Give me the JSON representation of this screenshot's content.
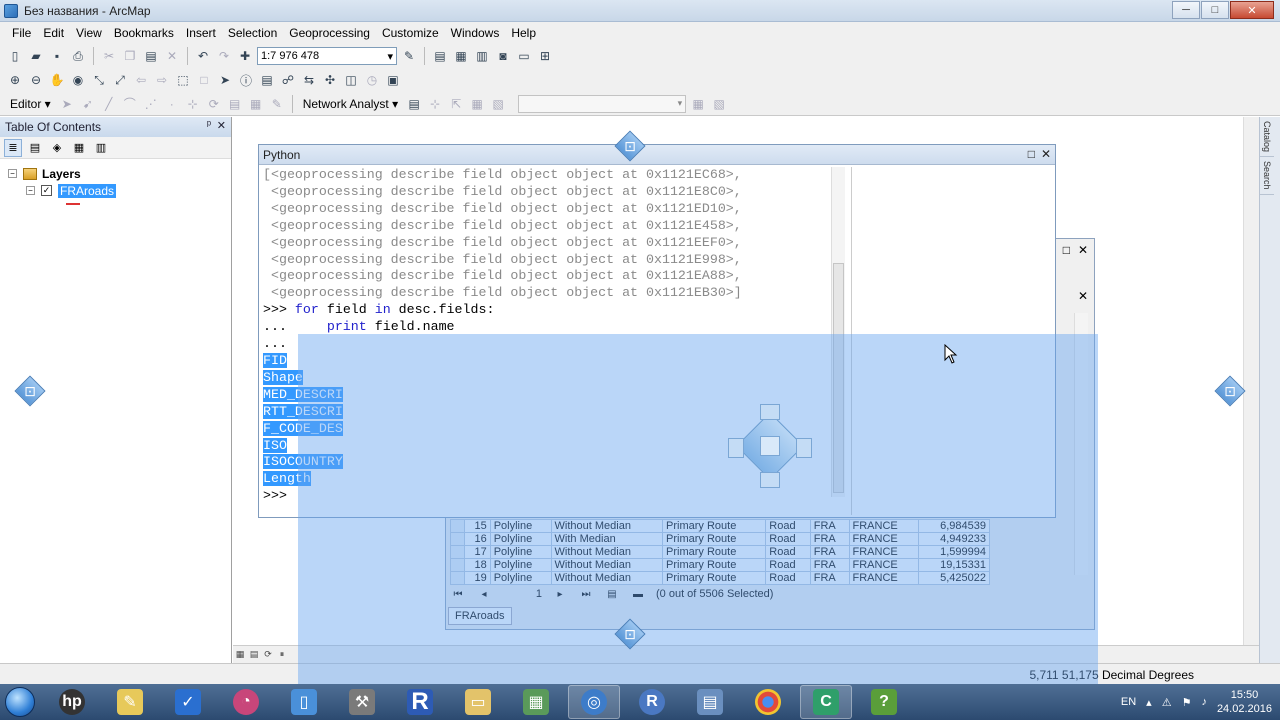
{
  "window": {
    "title": "Без названия - ArcMap",
    "min": "─",
    "max": "□",
    "close": "✕"
  },
  "menu": [
    "File",
    "Edit",
    "View",
    "Bookmarks",
    "Insert",
    "Selection",
    "Geoprocessing",
    "Customize",
    "Windows",
    "Help"
  ],
  "toolbar": {
    "scale": "1:7 976 478",
    "editor_label": "Editor ▾",
    "network_analyst": "Network Analyst ▾"
  },
  "toc": {
    "title": "Table Of Contents",
    "pin": "ᵖ",
    "close": "✕",
    "root_label": "Layers",
    "layer_label": "FRAroads"
  },
  "python": {
    "title": "Python",
    "max": "□",
    "close": "✕",
    "lines": [
      "[<geoprocessing describe field object object at 0x1121EC68>,",
      " <geoprocessing describe field object object at 0x1121E8C0>,",
      " <geoprocessing describe field object object at 0x1121ED10>,",
      " <geoprocessing describe field object object at 0x1121E458>,",
      " <geoprocessing describe field object object at 0x1121EEF0>,",
      " <geoprocessing describe field object object at 0x1121E998>,",
      " <geoprocessing describe field object object at 0x1121EA88>,",
      " <geoprocessing describe field object object at 0x1121EB30>]"
    ],
    "prompt": ">>> ",
    "for_kw": "for",
    "for_rest": " field ",
    "in_kw": "in",
    "for_tail": " desc.fields:",
    "cont1": "...     ",
    "print_kw": "print",
    "print_rest": " field.name",
    "cont2": "...",
    "fields": [
      "FID",
      "Shape",
      "MED_DESCRI",
      "RTT_DESCRI",
      "F_CODE_DES",
      "ISO",
      "ISOCOUNTRY",
      "Length"
    ],
    "final_prompt": ">>>"
  },
  "attribute_table": {
    "max": "□",
    "close": "✕",
    "rows": [
      [
        "15",
        "Polyline",
        "Without Median",
        "Primary Route",
        "Road",
        "FRA",
        "FRANCE",
        "6,984539"
      ],
      [
        "16",
        "Polyline",
        "With Median",
        "Primary Route",
        "Road",
        "FRA",
        "FRANCE",
        "4,949233"
      ],
      [
        "17",
        "Polyline",
        "Without Median",
        "Primary Route",
        "Road",
        "FRA",
        "FRANCE",
        "1,599994"
      ],
      [
        "18",
        "Polyline",
        "Without Median",
        "Primary Route",
        "Road",
        "FRA",
        "FRANCE",
        "19,15331"
      ],
      [
        "19",
        "Polyline",
        "Without Median",
        "Primary Route",
        "Road",
        "FRA",
        "FRANCE",
        "5,425022"
      ]
    ],
    "page": "1",
    "selection_status": "(0 out of 5506 Selected)",
    "tab_label": "FRAroads"
  },
  "right_dock": {
    "tab1": "Catalog",
    "tab2": "Search"
  },
  "status": {
    "coords": "5,711  51,175 Decimal Degrees"
  },
  "taskbar": {
    "lang": "EN",
    "time": "15:50",
    "date": "24.02.2016"
  },
  "colors": {
    "selection": "#3399ff",
    "overlay": "#66a4f0",
    "taskbar": "#2c4a70"
  }
}
